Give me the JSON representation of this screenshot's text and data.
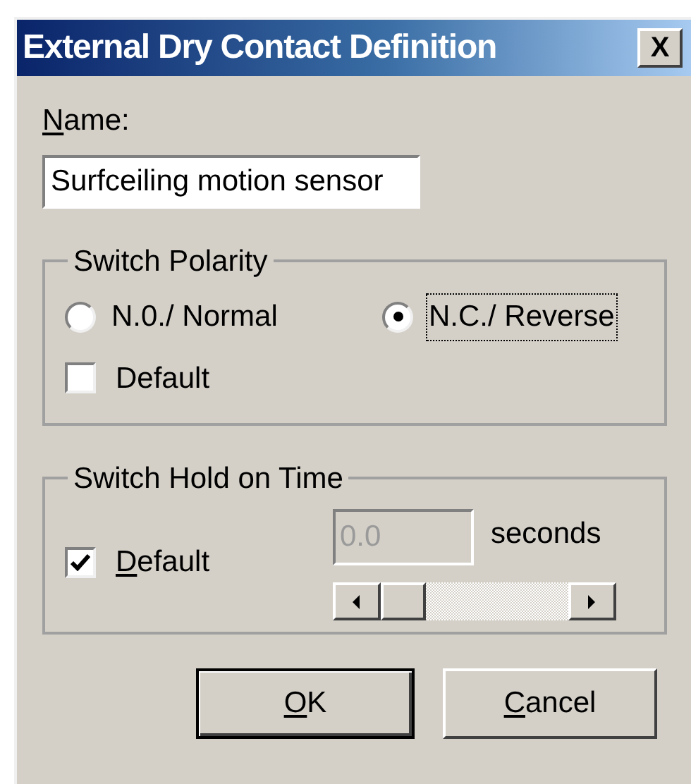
{
  "window": {
    "title": "External Dry Contact Definition",
    "close": "X"
  },
  "name_field": {
    "label": "Name:",
    "mnemonic": true,
    "value": "Surfceiling motion sensor"
  },
  "polarity": {
    "title": "Switch Polarity",
    "options": [
      {
        "label": "N.0./ Normal",
        "selected": false,
        "focused": false
      },
      {
        "label": "N.C./ Reverse",
        "selected": true,
        "focused": true
      }
    ],
    "default": {
      "label": "Default",
      "checked": false,
      "mnemonic": false
    }
  },
  "hold_time": {
    "title": "Switch Hold on Time",
    "default": {
      "label": "Default",
      "checked": true,
      "mnemonic": true
    },
    "field": {
      "value": "0.0",
      "disabled": true
    },
    "unit": "seconds"
  },
  "buttons": [
    {
      "label": "OK",
      "mnemonic": true,
      "default": true
    },
    {
      "label": "Cancel",
      "mnemonic": true,
      "default": false
    }
  ]
}
